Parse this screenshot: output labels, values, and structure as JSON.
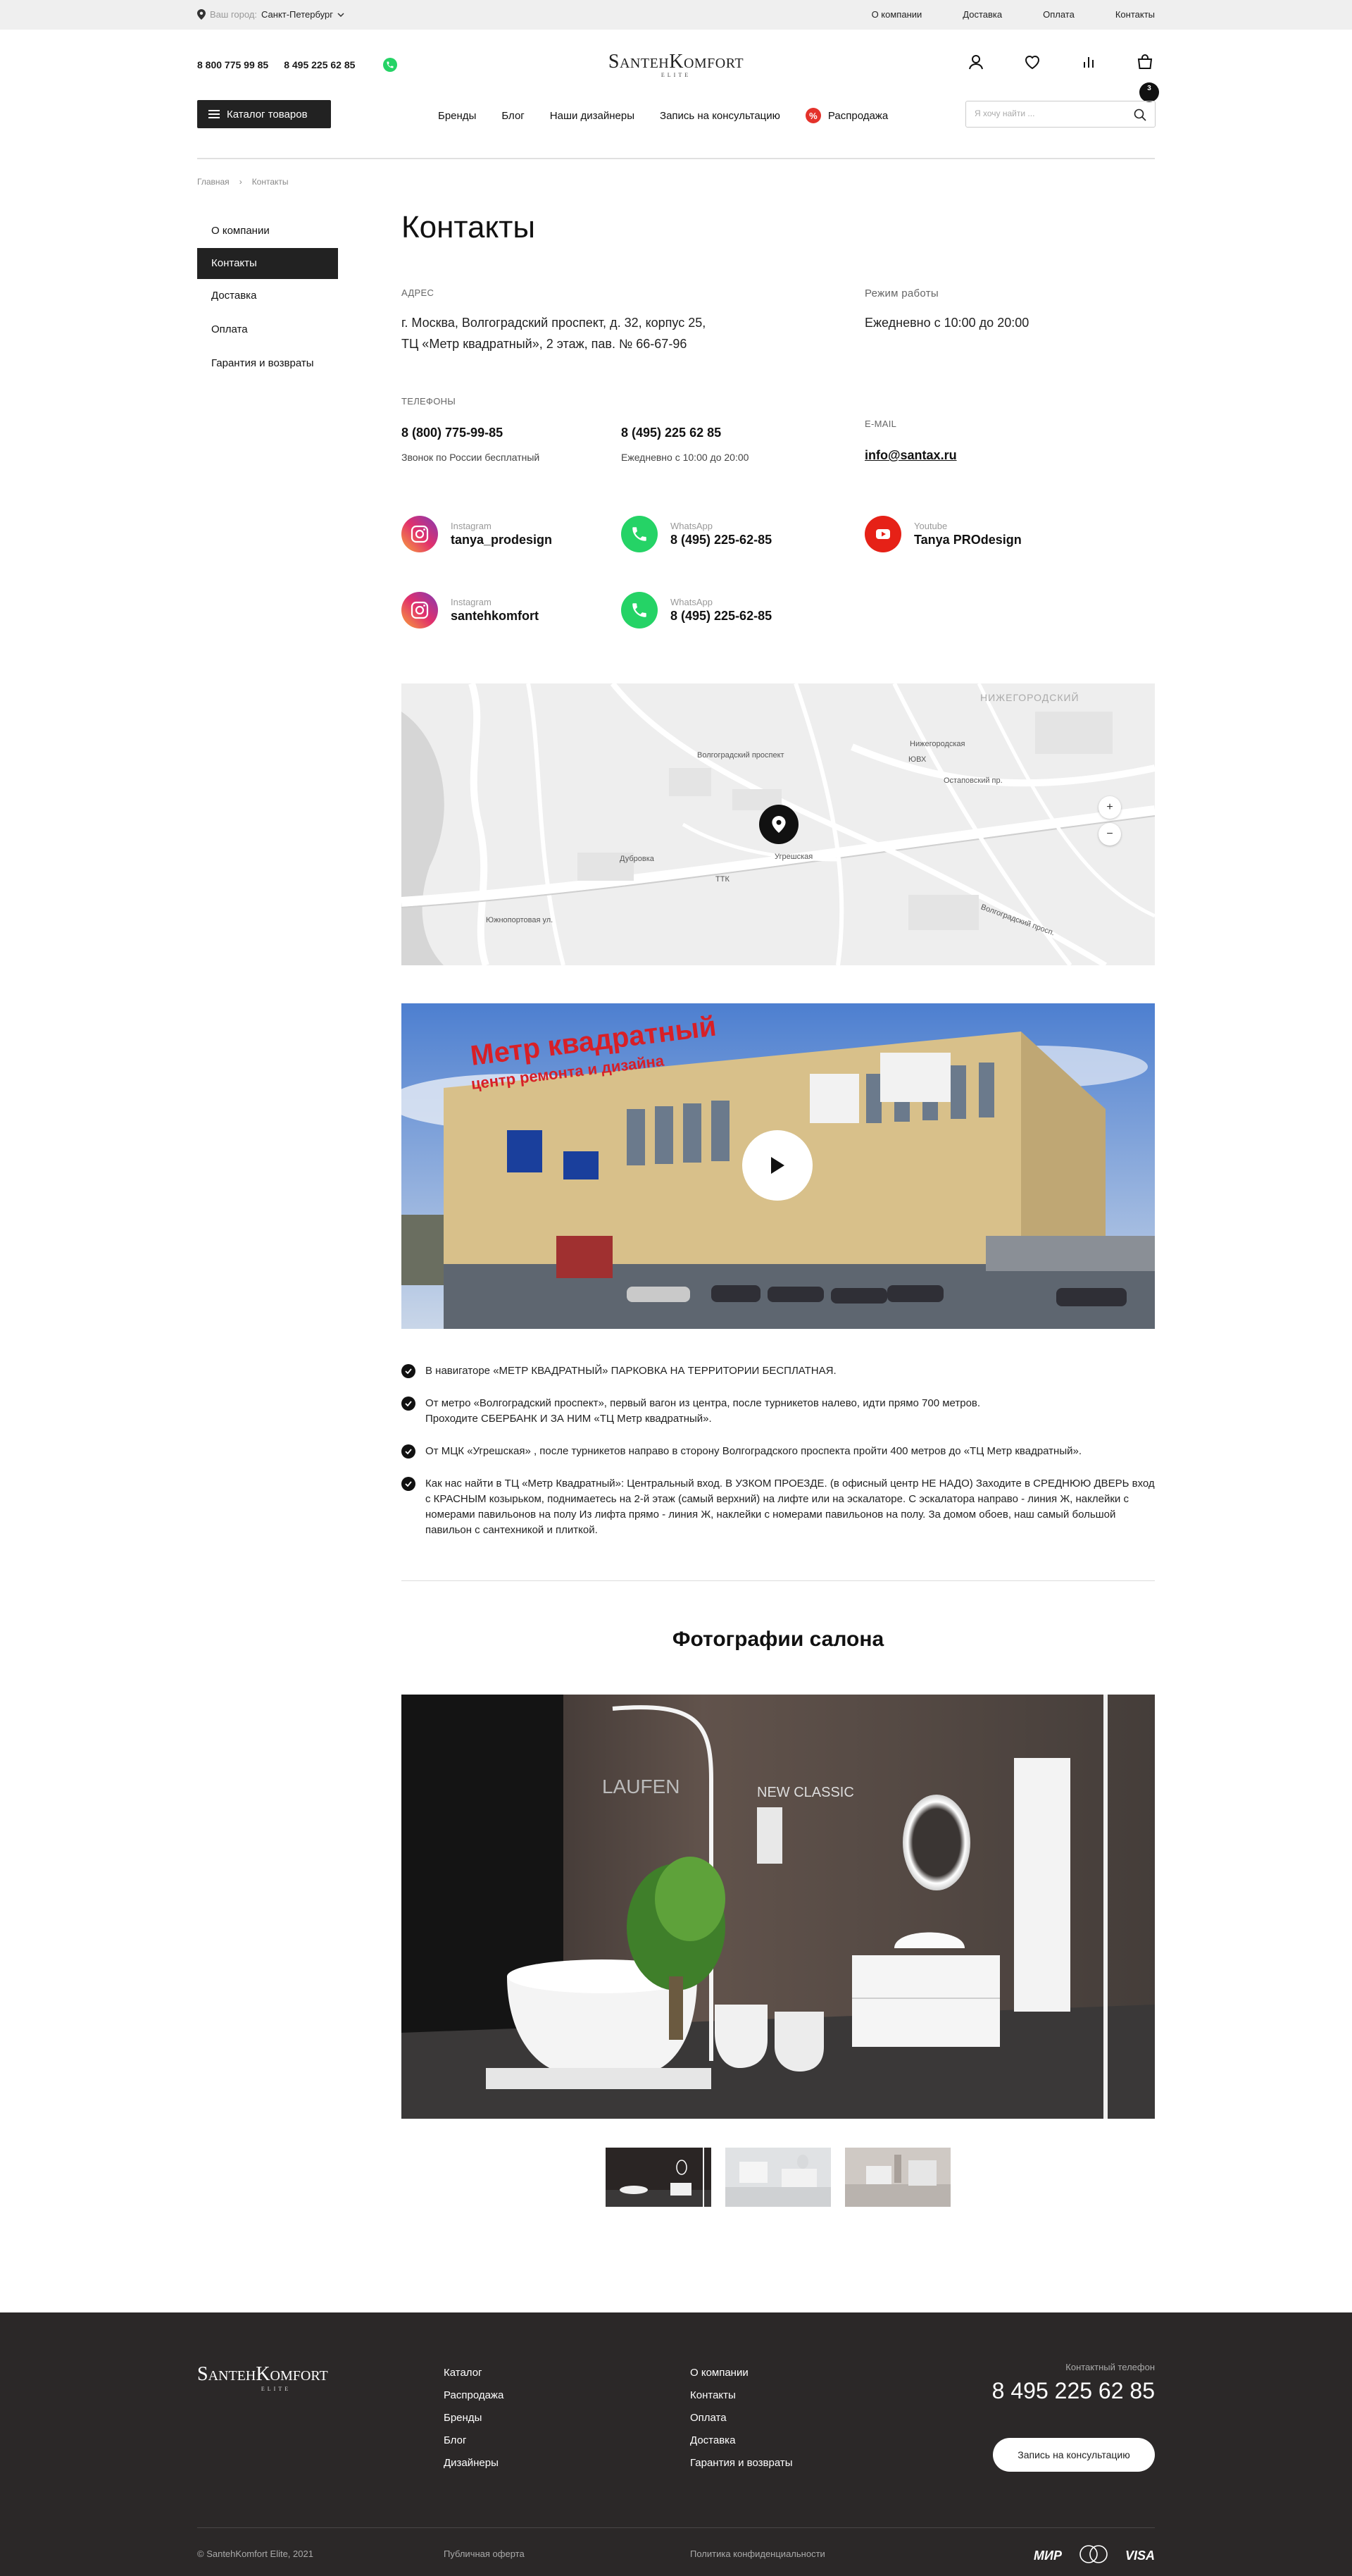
{
  "topbar": {
    "city_label": "Ваш город:",
    "city_value": "Санкт-Петербург",
    "links": [
      "О компании",
      "Доставка",
      "Оплата",
      "Контакты"
    ]
  },
  "header": {
    "phone1": "8 800 775 99 85",
    "phone2": "8 495 225 62 85",
    "logo_main": "SantehKomfort",
    "logo_sub": "ELITE",
    "cart_count": "3",
    "catalog_label": "Каталог товаров",
    "nav": [
      "Бренды",
      "Блог",
      "Наши дизайнеры",
      "Запись на консультацию"
    ],
    "sale_label": "Распродажа",
    "sale_icon": "%",
    "search_placeholder": "Я хочу найти ..."
  },
  "breadcrumbs": [
    "Главная",
    "Контакты"
  ],
  "sidebar": {
    "items": [
      "О компании",
      "Контакты",
      "Доставка",
      "Оплата",
      "Гарантия и возвраты"
    ],
    "active": "Контакты"
  },
  "contacts": {
    "title": "Контакты",
    "address_label": "АДРЕС",
    "address_line1": "г. Москва, Волгоградский проспект, д. 32, корпус 25,",
    "address_line2": "ТЦ «Метр квадратный»,  2 этаж, пав. № 66-67-96",
    "hours_label": "Режим работы",
    "hours_value": "Ежедневно с 10:00 до 20:00",
    "phones_label": "ТЕЛЕФОНЫ",
    "phone1": "8 (800) 775-99-85",
    "phone1_note": "Звонок по России бесплатный",
    "phone2": "8 (495) 225 62 85",
    "phone2_note": "Ежедневно с 10:00 до 20:00",
    "email_label": "E-MAIL",
    "email_value": "info@santax.ru",
    "socials": [
      {
        "kind": "Instagram",
        "value": "tanya_prodesign",
        "icon": "instagram-icon"
      },
      {
        "kind": "WhatsApp",
        "value": "8 (495) 225-62-85",
        "icon": "whatsapp-icon"
      },
      {
        "kind": "Youtube",
        "value": "Tanya PROdesign",
        "icon": "youtube-icon"
      },
      {
        "kind": "Instagram",
        "value": "santehkomfort",
        "icon": "instagram-icon"
      },
      {
        "kind": "WhatsApp",
        "value": "8 (495) 225-62-85",
        "icon": "whatsapp-icon"
      }
    ]
  },
  "map": {
    "district": "НИЖЕГОРОДСКИЙ",
    "labels": [
      "Волгоградский проспект",
      "Дубровка",
      "Угрешская",
      "Нижегородская",
      "ЮВХ",
      "ТТК",
      "Остаповский пр.",
      "Волгоградский просп.",
      "Южнопортовая ул."
    ],
    "zoom_in": "+",
    "zoom_out": "−"
  },
  "video": {
    "sign_line1": "Метр квадратный",
    "sign_line2": "центр ремонта и дизайна"
  },
  "notes": [
    "В навигаторе «МЕТР КВАДРАТНЫЙ» ПАРКОВКА НА ТЕРРИТОРИИ БЕСПЛАТНАЯ.",
    "От метро «Волгоградский проспект», первый вагон из центра, после турникетов налево, идти прямо 700 метров.\nПроходите СБЕРБАНК И ЗА НИМ  «ТЦ Метр квадратный».",
    "От МЦК «Угрешская» , после турникетов направо в сторону Волгоградского проспекта пройти 400 метров до «ТЦ Метр квадратный».",
    "Как нас найти в ТЦ «Метр Квадратный»: Центральный вход. В УЗКОМ ПРОЕЗДЕ. (в офисный центр НЕ НАДО) Заходите в СРЕДНЮЮ ДВЕРЬ вход с КРАСНЫМ козырьком, поднимаетесь на 2-й этаж (самый верхний) на лифте или на эскалаторе. С эскалатора направо - линия Ж, наклейки с номерами павильонов на полу Из лифта прямо - линия Ж, наклейки с номерами павильонов на полу. За домом обоев, наш самый большой павильон с сантехникой и плиткой."
  ],
  "photos": {
    "title": "Фотографии салона",
    "sign_brand": "LAUFEN",
    "sign_collection": "NEW CLASSIC",
    "thumb_count": 3
  },
  "footer": {
    "logo_main": "SantehKomfort",
    "logo_sub": "ELITE",
    "col1": [
      "Каталог",
      "Распродажа",
      "Бренды",
      "Блог",
      "Дизайнеры"
    ],
    "col2": [
      "О компании",
      "Контакты",
      "Оплата",
      "Доставка",
      "Гарантия и возвраты"
    ],
    "contact_label": "Контактный телефон",
    "contact_phone": "8 495 225 62 85",
    "cta": "Запись на консультацию",
    "copyright": "© SantehKomfort Elite, 2021",
    "offer": "Публичная оферта",
    "privacy": "Политика конфиденциальности",
    "pay_mir": "МИР",
    "pay_visa": "VISA"
  },
  "colors": {
    "accent_dark": "#222222",
    "sale_red": "#e4322b",
    "whatsapp": "#25d366",
    "youtube": "#e62117",
    "footer_bg": "#2b2828"
  }
}
